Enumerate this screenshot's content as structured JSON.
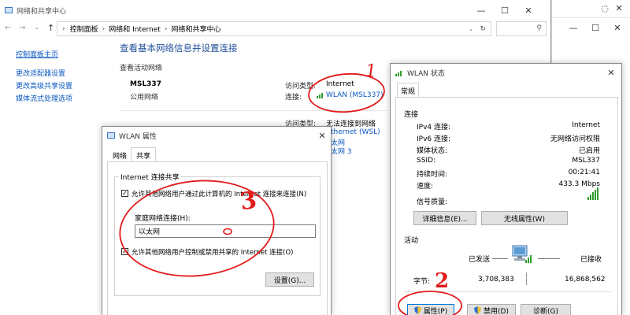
{
  "main_window": {
    "title": "网络和共享中心",
    "breadcrumb": [
      "控制面板",
      "网络和 Internet",
      "网络和共享中心"
    ],
    "sidebar_items": [
      "控制面板主页",
      "更改适配器设置",
      "更改高级共享设置",
      "媒体流式处理选项"
    ],
    "heading": "查看基本网络信息并设置连接",
    "section_active": "查看活动网络",
    "network1_name": "MSL337",
    "network1_type": "公用网络",
    "access_type_label": "访问类型:",
    "access_type_value": "Internet",
    "connection_label": "连接:",
    "connection_value": "WLAN (MSL337)",
    "access_type_value2": "无法连接到网络",
    "ethernet_wsl": "thernet (WSL)",
    "ethernet3": "太网 3",
    "ethernet_mid": "太网"
  },
  "wlan_props": {
    "title": "WLAN 属性",
    "tabs": [
      "网络",
      "共享"
    ],
    "group_title": "Internet 连接共享",
    "checkbox1": "允许其他网络用户通过此计算机的 Internet 连接来连接(N)",
    "home_label": "家庭网络连接(H):",
    "home_value": "以太网",
    "checkbox2": "允许其他网络用户控制或禁用共享的 Internet 连接(O)",
    "settings_button": "设置(G)..."
  },
  "wlan_status": {
    "title": "WLAN 状态",
    "tab": "常规",
    "section_connection": "连接",
    "rows": [
      {
        "label": "IPv4 连接:",
        "value": "Internet"
      },
      {
        "label": "IPv6 连接:",
        "value": "无网络访问权限"
      },
      {
        "label": "媒体状态:",
        "value": "已启用"
      },
      {
        "label": "SSID:",
        "value": "MSL337"
      },
      {
        "label": "持续时间:",
        "value": "00:21:41"
      },
      {
        "label": "速度:",
        "value": "433.3 Mbps"
      }
    ],
    "signal_label": "信号质量:",
    "details_button": "详细信息(E)...",
    "wireless_button": "无线属性(W)",
    "section_activity": "活动",
    "sent_label": "已发送",
    "received_label": "已接收",
    "bytes_label": "字节:",
    "bytes_sent": "3,708,383",
    "bytes_received": "16,868,562",
    "properties_button": "属性(P)",
    "disable_button": "禁用(D)",
    "diagnose_button": "诊断(G)"
  },
  "annotations": [
    "1",
    "2",
    "3"
  ],
  "colors": {
    "link": "#0a58c2",
    "annotation": "#e21b1b",
    "signal": "#2e9d2e"
  }
}
